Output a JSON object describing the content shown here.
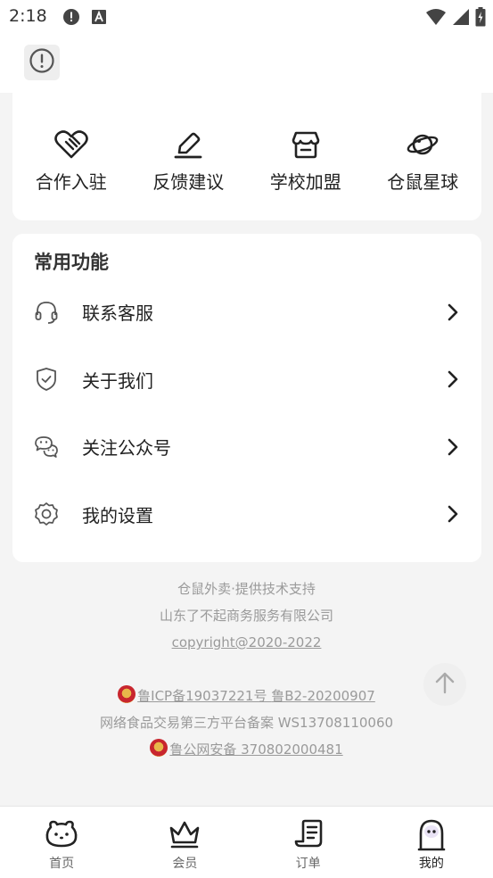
{
  "status_bar": {
    "time": "2:18",
    "icons": [
      "alert-circle-icon",
      "font-a-icon",
      "wifi-icon",
      "signal-icon",
      "battery-charging-icon"
    ]
  },
  "top_bar": {
    "icon": "alert-circle-icon"
  },
  "shortcuts": [
    {
      "label": "合作入驻",
      "icon": "handshake-heart-icon"
    },
    {
      "label": "反馈建议",
      "icon": "pen-edit-icon"
    },
    {
      "label": "学校加盟",
      "icon": "store-icon"
    },
    {
      "label": "仓鼠星球",
      "icon": "planet-icon"
    }
  ],
  "common_functions": {
    "title": "常用功能",
    "items": [
      {
        "label": "联系客服",
        "icon": "headset-icon"
      },
      {
        "label": "关于我们",
        "icon": "shield-check-icon"
      },
      {
        "label": "关注公众号",
        "icon": "wechat-icon"
      },
      {
        "label": "我的设置",
        "icon": "gear-icon"
      }
    ]
  },
  "footer": {
    "line1": "仓鼠外卖·提供技术支持",
    "line2": "山东了不起商务服务有限公司",
    "copyright": "copyright@2020-2022",
    "icp": "鲁ICP备19037221号 ",
    "b2": "鲁B2-20200907",
    "food_record": "网络食品交易第三方平台备案 WS13708110060",
    "police_record": "鲁公网安备 370802000481"
  },
  "tabs": [
    {
      "label": "首页",
      "icon": "hamster-icon",
      "active": false
    },
    {
      "label": "会员",
      "icon": "crown-icon",
      "active": false
    },
    {
      "label": "订单",
      "icon": "order-list-icon",
      "active": false
    },
    {
      "label": "我的",
      "icon": "profile-avatar-icon",
      "active": true
    }
  ],
  "colors": {
    "background": "#f4f4f4",
    "card": "#ffffff",
    "text": "#222222",
    "muted": "#9a9a9a",
    "icon": "#333333"
  }
}
